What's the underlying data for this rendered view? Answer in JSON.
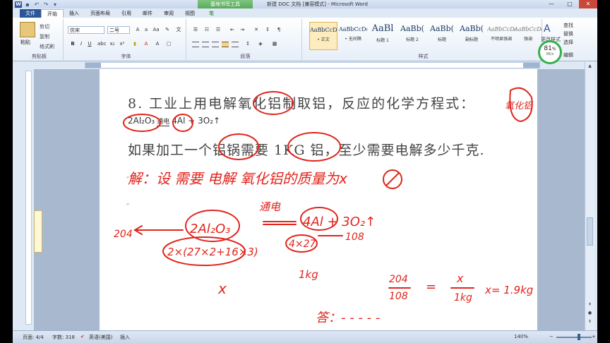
{
  "window": {
    "title": "新建 DOC 文档 [兼容模式] - Microsoft Word",
    "context_tab_group": "基地书写工具",
    "minimize": "—",
    "maximize": "□",
    "close": "✕"
  },
  "quick_access": {
    "save_icon": "save-icon",
    "undo_icon": "undo-icon",
    "redo_icon": "redo-icon"
  },
  "tabs": [
    "文件",
    "开始",
    "插入",
    "页面布局",
    "引用",
    "邮件",
    "审阅",
    "视图",
    "笔"
  ],
  "ribbon": {
    "clipboard": {
      "paste": "粘贴",
      "cut": "剪切",
      "copy": "复制",
      "format_painter": "格式刷",
      "group": "剪贴板"
    },
    "font": {
      "font_name": "仿宋",
      "font_size": "二号",
      "group": "字体"
    },
    "paragraph": {
      "group": "段落"
    },
    "styles": {
      "group": "样式",
      "items": [
        {
          "sample": "AaBbCcDd",
          "name": "• 正文"
        },
        {
          "sample": "AaBbCcDd",
          "name": "• 无间隔"
        },
        {
          "sample": "AaBl",
          "name": "标题 1"
        },
        {
          "sample": "AaBb(",
          "name": "标题 2"
        },
        {
          "sample": "AaBb(",
          "name": "标题"
        },
        {
          "sample": "AaBb(",
          "name": "副标题"
        },
        {
          "sample": "AaBbCcDd",
          "name": "不明显强调"
        },
        {
          "sample": "AaBbCcDd",
          "name": "强调"
        }
      ],
      "change_styles": "更改样式"
    },
    "editing": {
      "find": "查找",
      "replace": "替换",
      "select": "选择",
      "group": "编辑"
    }
  },
  "network_badge": {
    "percent": "81",
    "unit": "%",
    "speed": "0K/s"
  },
  "document": {
    "question_line": "8. 工业上用电解氧化铝制取铝，反应的化学方程式：",
    "equation": {
      "reactant": "2Al₂O₃",
      "condition": "通电",
      "products": "4Al + 3O₂↑"
    },
    "question_line2": "如果加工一个铝锅需要 1KG 铝，至少需要电解多少千克."
  },
  "handwriting": {
    "oxide_note": "氧化铝",
    "solution_line": "解：设 需要 电解 氧化铝的质量为x",
    "condition": "通电",
    "reactant": "2Al₂O₃",
    "products": "4Al + 3O₂↑",
    "mass_left": "204",
    "calc_left": "2×(27×2+16×3)",
    "calc_right": "4×27",
    "mass_right": "108",
    "unknown": "x",
    "known": "1kg",
    "proportion_num": "204",
    "proportion_den": "108",
    "equals": "=",
    "rhs_num": "x",
    "rhs_den": "1kg",
    "answer_x": "x= 1.9kg",
    "answer_line": "答：- - - - -"
  },
  "status": {
    "page": "页面: 4/4",
    "words": "字数: 318",
    "language": "英语(美国)",
    "mode": "插入",
    "zoom": "140%",
    "zoom_minus": "−",
    "zoom_plus": "+"
  },
  "colors": {
    "ink": "#e0241c",
    "ribbon_accent": "#2b579a",
    "badge_ring": "#34b04a"
  }
}
